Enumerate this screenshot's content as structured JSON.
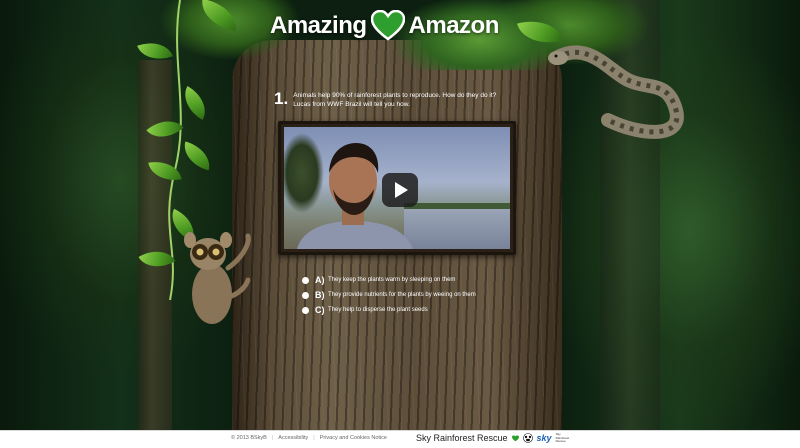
{
  "header": {
    "logo_word_1": "Amazing",
    "logo_word_2": "Amazon",
    "logo_heart_icon": "heart-icon",
    "accent_color": "#2e9e2e"
  },
  "question": {
    "number": "1.",
    "text": "Animals help 90% of rainforest plants to reproduce. How do they do it? Lucas from WWF Brazil will tell you how."
  },
  "video": {
    "play_icon": "play-icon"
  },
  "answers": [
    {
      "letter": "A)",
      "text": "They keep the plants warm by sleeping on them"
    },
    {
      "letter": "B)",
      "text": "They provide nutrients for the plants by weeing on them"
    },
    {
      "letter": "C)",
      "text": "They help to disperse the plant seeds"
    }
  ],
  "footer": {
    "copyright": "© 2013 BSkyB",
    "accessibility": "Accessibility",
    "privacy": "Privacy and Cookies Notice",
    "brand": "Sky Rainforest Rescue",
    "sky": "sky",
    "partner_text": "Sky Rainforest Rescue"
  }
}
